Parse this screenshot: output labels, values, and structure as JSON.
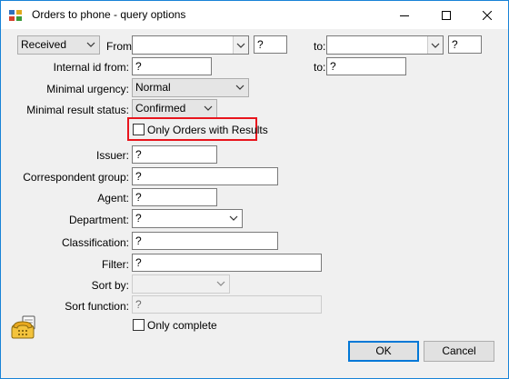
{
  "window": {
    "title": "Orders to phone - query options"
  },
  "date_range": {
    "type_value": "Received",
    "from_label": "From:",
    "from_value": "",
    "from_extra": "?",
    "to_label": "to:",
    "to_value": "",
    "to_extra": "?"
  },
  "internal_id": {
    "label": "Internal id from:",
    "from_value": "?",
    "to_label": "to:",
    "to_value": "?"
  },
  "minimal_urgency": {
    "label": "Minimal urgency:",
    "value": "Normal"
  },
  "minimal_result_status": {
    "label": "Minimal result status:",
    "value": "Confirmed"
  },
  "only_orders_with_results": {
    "label": "Only Orders with Results",
    "checked": false
  },
  "issuer": {
    "label": "Issuer:",
    "value": "?"
  },
  "correspondent_group": {
    "label": "Correspondent group:",
    "value": "?"
  },
  "agent": {
    "label": "Agent:",
    "value": "?"
  },
  "department": {
    "label": "Department:",
    "value": "?"
  },
  "classification": {
    "label": "Classification:",
    "value": "?"
  },
  "filter": {
    "label": "Filter:",
    "value": "?"
  },
  "sort_by": {
    "label": "Sort by:",
    "value": ""
  },
  "sort_function": {
    "label": "Sort function:",
    "value": "?"
  },
  "only_complete": {
    "label": "Only complete",
    "checked": false
  },
  "buttons": {
    "ok": "OK",
    "cancel": "Cancel"
  },
  "colors": {
    "highlight": "#e8151d",
    "window_border": "#1883d7",
    "dialog_bg": "#f0f0f0",
    "default_button": "#0078d7"
  },
  "icons": {
    "app": "dialog-app-icon",
    "decor": "telephone-icon"
  }
}
